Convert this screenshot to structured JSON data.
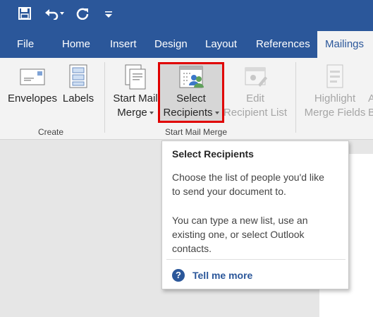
{
  "quick_access": {
    "save_icon": "save-icon",
    "undo_icon": "undo-icon",
    "redo_icon": "repeat-icon",
    "customize_icon": "customize-icon"
  },
  "tabs": {
    "file": "File",
    "home": "Home",
    "insert": "Insert",
    "design": "Design",
    "layout": "Layout",
    "references": "References",
    "mailings": "Mailings"
  },
  "ribbon": {
    "envelopes": "Envelopes",
    "labels": "Labels",
    "create_group": "Create",
    "start_mail_merge_line1": "Start Mail",
    "start_mail_merge_line2": "Merge",
    "select_recipients_line1": "Select",
    "select_recipients_line2": "Recipients",
    "edit_recipient_line1": "Edit",
    "edit_recipient_line2": "Recipient List",
    "start_mail_merge_group": "Start Mail Merge",
    "highlight_line1": "Highlight",
    "highlight_line2": "Merge Fields",
    "address_line1": "A",
    "address_line2": "Bl"
  },
  "tooltip": {
    "title": "Select Recipients",
    "text1_line1": "Choose the list of people you'd like",
    "text1_line2": "to send your document to.",
    "text2_line1": "You can type a new list, use an",
    "text2_line2": "existing one, or select Outlook",
    "text2_line3": "contacts.",
    "link": "Tell me more"
  },
  "colors": {
    "accent": "#2b579a",
    "highlight_border": "#e00000"
  }
}
